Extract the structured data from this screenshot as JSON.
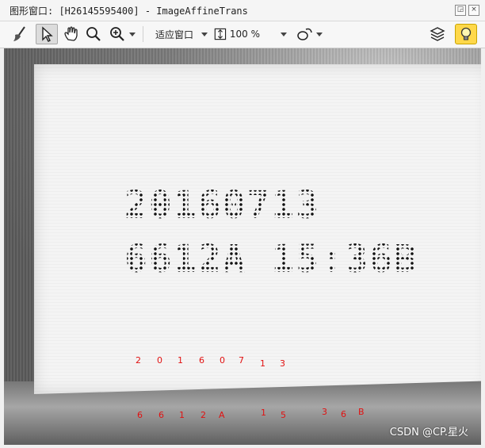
{
  "window": {
    "title": "图形窗口: [H26145595400] - ImageAffineTrans",
    "restore_symbol": "◲",
    "close_symbol": "×"
  },
  "toolbar": {
    "tools": [
      {
        "name": "brush-icon"
      },
      {
        "name": "pointer-icon",
        "selected": true
      },
      {
        "name": "hand-icon"
      },
      {
        "name": "zoom-icon"
      },
      {
        "name": "zoom-in-icon"
      }
    ],
    "fit_mode_label": "适应窗口",
    "zoom_value": "100 %",
    "bulb_color": "#ffd84a"
  },
  "image": {
    "printed_line_1": "20160713",
    "printed_line_2": "6612A 15:36B",
    "recognized_line_1": [
      "2",
      "0",
      "1",
      "6",
      "0",
      "7",
      "1",
      "3"
    ],
    "recognized_line_2": [
      "6",
      "6",
      "1",
      "2",
      "A",
      "1",
      "5",
      "3",
      "6",
      "B"
    ],
    "recognized_color": "#e11111"
  },
  "watermark": "CSDN @CP.星火"
}
